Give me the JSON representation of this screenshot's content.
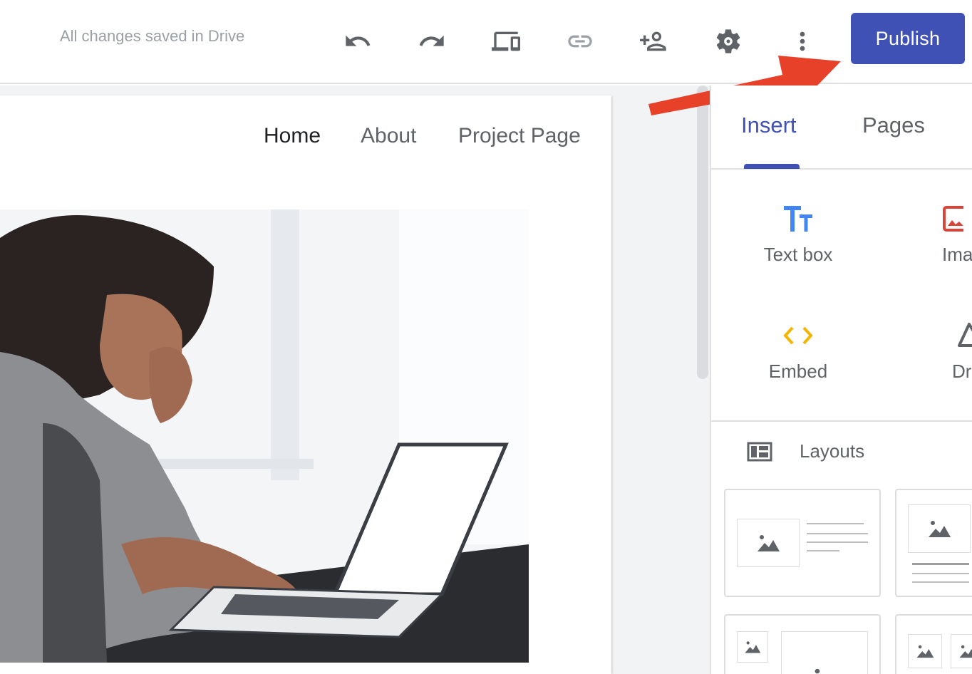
{
  "toolbar": {
    "status_text": "All changes saved in Drive",
    "icons": [
      "undo-icon",
      "redo-icon",
      "preview-devices-icon",
      "link-icon",
      "share-icon",
      "settings-icon",
      "more-vert-icon"
    ],
    "publish_label": "Publish"
  },
  "site": {
    "nav": [
      {
        "label": "Home",
        "active": true
      },
      {
        "label": "About",
        "active": false
      },
      {
        "label": "Project Page",
        "active": false
      }
    ]
  },
  "panel": {
    "tabs": [
      {
        "label": "Insert",
        "active": true
      },
      {
        "label": "Pages",
        "active": false
      }
    ],
    "insert_items": [
      {
        "label": "Text box",
        "icon": "text-box-icon"
      },
      {
        "label": "Ima",
        "icon": "image-icon"
      },
      {
        "label": "Embed",
        "icon": "embed-icon"
      },
      {
        "label": "Dr",
        "icon": "drive-icon"
      }
    ],
    "layouts_label": "Layouts"
  },
  "colors": {
    "accent": "#3f51b5",
    "publish_bg": "#3f51b5",
    "text_icon_blue": "#4285f4",
    "image_icon_red": "#db4437",
    "embed_icon_yellow": "#f4b400",
    "arrow_red": "#e8412a",
    "muted_text": "#5f6368"
  }
}
